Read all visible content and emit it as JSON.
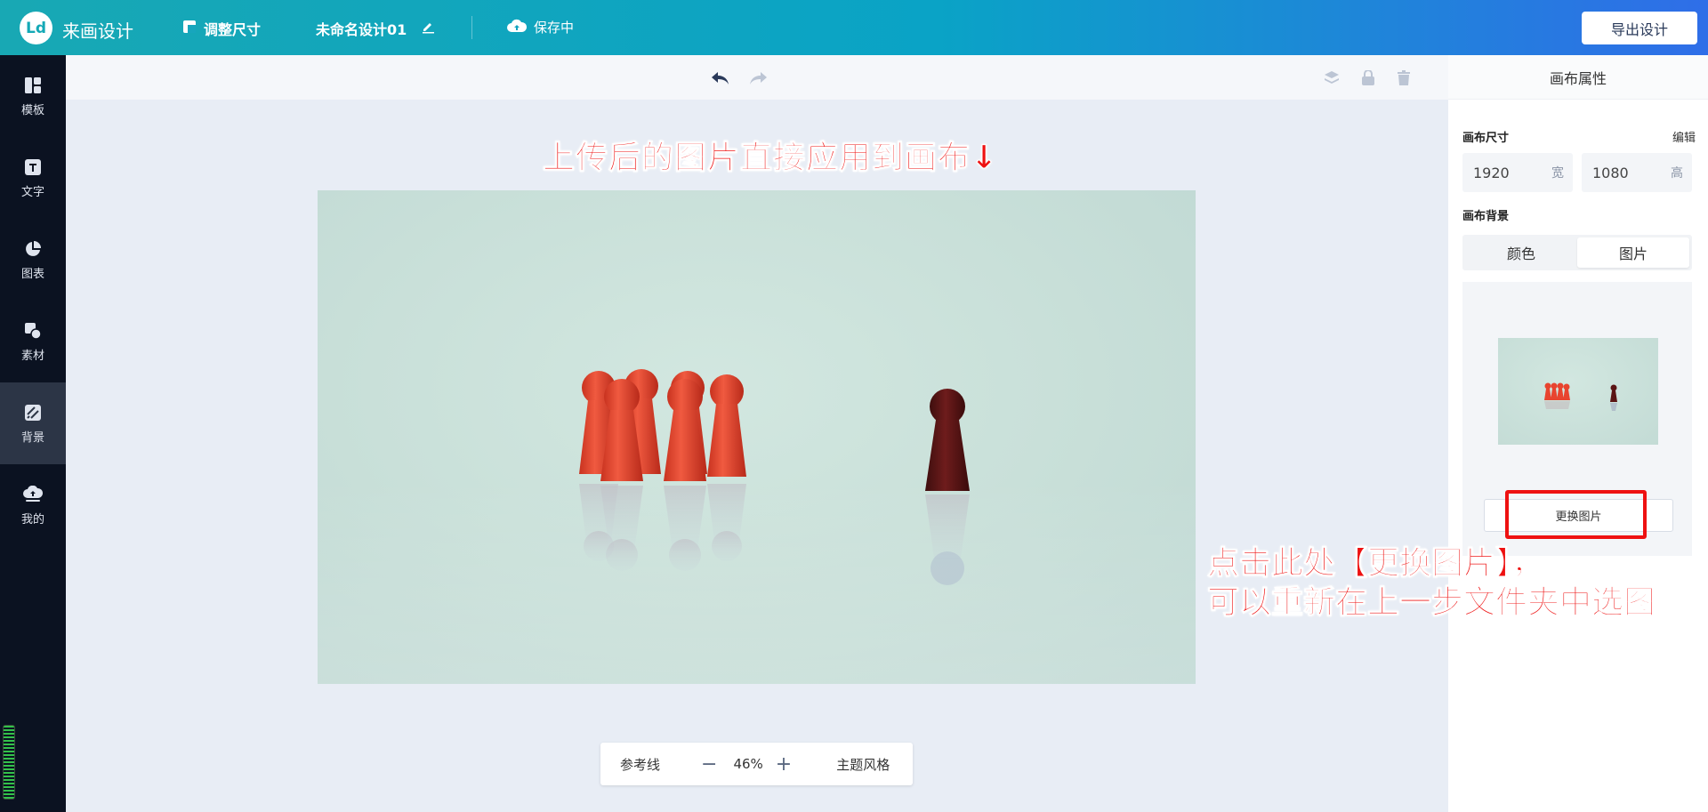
{
  "header": {
    "logo_text": "Ld",
    "app_name": "来画设计",
    "resize_label": "调整尺寸",
    "doc_name": "未命名设计01",
    "save_status": "保存中",
    "export_label": "导出设计"
  },
  "sidebar": {
    "items": [
      {
        "label": "模板",
        "icon": "template-icon"
      },
      {
        "label": "文字",
        "icon": "text-icon"
      },
      {
        "label": "图表",
        "icon": "chart-icon"
      },
      {
        "label": "素材",
        "icon": "material-icon"
      },
      {
        "label": "背景",
        "icon": "background-icon",
        "active": true
      },
      {
        "label": "我的",
        "icon": "upload-cloud-icon"
      }
    ]
  },
  "canvas": {
    "annotation_top": "上传后的图片直接应用到画布↓",
    "zoom": {
      "guides_label": "参考线",
      "minus": "−",
      "value": "46%",
      "plus": "+",
      "theme_label": "主题风格"
    }
  },
  "panel": {
    "title": "画布属性",
    "size_label": "画布尺寸",
    "edit_label": "编辑",
    "width_value": "1920",
    "width_unit": "宽",
    "height_value": "1080",
    "height_unit": "高",
    "bg_label": "画布背景",
    "tabs": [
      {
        "label": "颜色",
        "active": false
      },
      {
        "label": "图片",
        "active": true
      }
    ],
    "replace_button": "更换图片",
    "annotation_line1": "点击此处【更换图片】，",
    "annotation_line2": "可以重新在上一步文件夹中选图"
  },
  "colors": {
    "accent_red": "#ee1111",
    "pawn_red": "#e8442f",
    "pawn_dark": "#5a1414",
    "topbar_start": "#18a8b4",
    "topbar_end": "#2f6ee8"
  }
}
